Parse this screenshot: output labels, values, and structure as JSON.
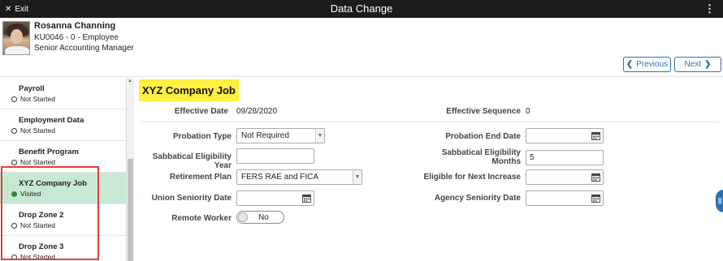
{
  "topbar": {
    "exit_label": "Exit",
    "title": "Data Change",
    "more_label": "⋮"
  },
  "employee": {
    "name": "Rosanna Channing",
    "id_line": "KU0046 - 0 - Employee",
    "job_title": "Senior Accounting Manager"
  },
  "nav": {
    "previous_label": "Previous",
    "next_label": "Next"
  },
  "sidebar": {
    "items": [
      {
        "label": "Payroll",
        "status": "Not Started",
        "active": false
      },
      {
        "label": "Employment Data",
        "status": "Not Started",
        "active": false
      },
      {
        "label": "Benefit Program",
        "status": "Not Started",
        "active": false
      },
      {
        "label": "XYZ Company Job",
        "status": "Visited",
        "active": true
      },
      {
        "label": "Drop Zone 2",
        "status": "Not Started",
        "active": false
      },
      {
        "label": "Drop Zone 3",
        "status": "Not Started",
        "active": false
      }
    ]
  },
  "form": {
    "section_title": "XYZ Company Job",
    "effective_date": {
      "label": "Effective Date",
      "value": "09/28/2020"
    },
    "effective_sequence": {
      "label": "Effective Sequence",
      "value": "0"
    },
    "probation_type": {
      "label": "Probation Type",
      "value": "Not Required"
    },
    "probation_end_date": {
      "label": "Probation End Date",
      "value": ""
    },
    "sabbatical_year": {
      "label": "Sabbatical Eligibility Year",
      "value": ""
    },
    "sabbatical_months": {
      "label_line1": "Sabbatical Eligibility",
      "label_line2": "Months",
      "value": "5"
    },
    "retirement_plan": {
      "label": "Retirement Plan",
      "value": "FERS RAE and FICA"
    },
    "next_increase": {
      "label": "Eligible for Next Increase",
      "value": ""
    },
    "union_seniority": {
      "label": "Union Seniority Date",
      "value": ""
    },
    "agency_seniority": {
      "label": "Agency Seniority Date",
      "value": ""
    },
    "remote_worker": {
      "label": "Remote Worker",
      "value": "No"
    }
  },
  "icons": {
    "exit": "close-icon",
    "calendar": "calendar-icon",
    "prev": "chevron-left-icon",
    "next": "chevron-right-icon",
    "dropdown": "chevron-down-icon"
  },
  "colors": {
    "topbar_bg": "#1c1c1c",
    "accent": "#2c6fb5",
    "active_step_bg": "#c9e8d3",
    "visited_dot": "#2b8a3e",
    "section_highlight": "#ffef3f",
    "annotation_box": "#e0403a"
  }
}
